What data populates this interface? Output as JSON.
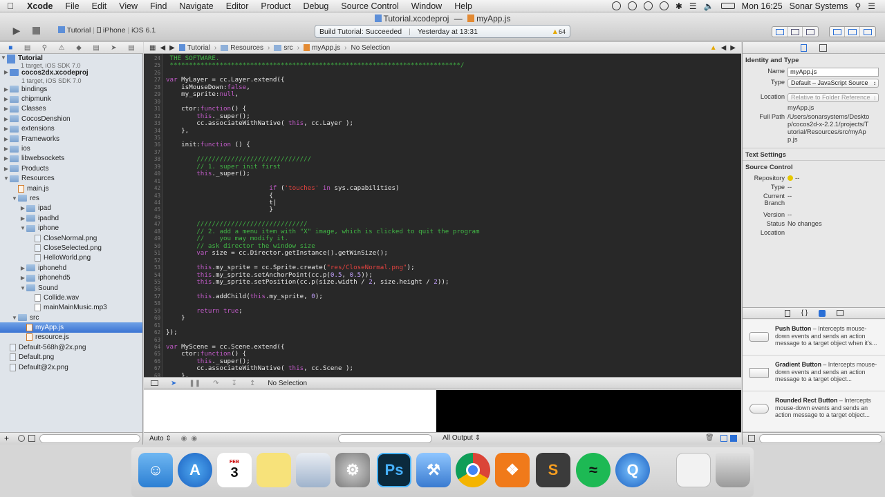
{
  "menubar": {
    "app": "Xcode",
    "items": [
      "File",
      "Edit",
      "View",
      "Find",
      "Navigate",
      "Editor",
      "Product",
      "Debug",
      "Source Control",
      "Window",
      "Help"
    ],
    "clock": "Mon 16:25",
    "user": "Sonar Systems"
  },
  "window": {
    "title_project": "Tutorial.xcodeproj",
    "title_sep": "—",
    "title_file": "myApp.js"
  },
  "toolbar": {
    "scheme": "Tutorial",
    "device": "iPhone",
    "sdk": "iOS 6.1",
    "activity_status": "Build Tutorial: Succeeded",
    "activity_time": "Yesterday at 13:31",
    "warning_count": "64"
  },
  "navigator": {
    "project": {
      "name": "Tutorial",
      "sub": "1 target, iOS SDK 7.0"
    },
    "items": [
      {
        "label": "cocos2dx.xcodeproj",
        "sub": "1 target, iOS SDK 7.0",
        "type": "proj",
        "indent": 1,
        "tri": "closed"
      },
      {
        "label": "bindings",
        "type": "folder",
        "indent": 1,
        "tri": "closed"
      },
      {
        "label": "chipmunk",
        "type": "folder",
        "indent": 1,
        "tri": "closed"
      },
      {
        "label": "Classes",
        "type": "folder",
        "indent": 1,
        "tri": "closed"
      },
      {
        "label": "CocosDenshion",
        "type": "folder",
        "indent": 1,
        "tri": "closed"
      },
      {
        "label": "extensions",
        "type": "folder",
        "indent": 1,
        "tri": "closed"
      },
      {
        "label": "Frameworks",
        "type": "folder",
        "indent": 1,
        "tri": "closed"
      },
      {
        "label": "ios",
        "type": "folder",
        "indent": 1,
        "tri": "closed"
      },
      {
        "label": "libwebsockets",
        "type": "folder",
        "indent": 1,
        "tri": "closed"
      },
      {
        "label": "Products",
        "type": "folder",
        "indent": 1,
        "tri": "closed"
      },
      {
        "label": "Resources",
        "type": "folder",
        "indent": 1,
        "tri": "open"
      },
      {
        "label": "main.js",
        "type": "js",
        "indent": 2,
        "tri": ""
      },
      {
        "label": "res",
        "type": "folder",
        "indent": 2,
        "tri": "open"
      },
      {
        "label": "ipad",
        "type": "folder",
        "indent": 3,
        "tri": "closed"
      },
      {
        "label": "ipadhd",
        "type": "folder",
        "indent": 3,
        "tri": "closed"
      },
      {
        "label": "iphone",
        "type": "folder",
        "indent": 3,
        "tri": "open"
      },
      {
        "label": "CloseNormal.png",
        "type": "img",
        "indent": 4,
        "tri": ""
      },
      {
        "label": "CloseSelected.png",
        "type": "img",
        "indent": 4,
        "tri": ""
      },
      {
        "label": "HelloWorld.png",
        "type": "img",
        "indent": 4,
        "tri": ""
      },
      {
        "label": "iphonehd",
        "type": "folder",
        "indent": 3,
        "tri": "closed"
      },
      {
        "label": "iphonehd5",
        "type": "folder",
        "indent": 3,
        "tri": "closed"
      },
      {
        "label": "Sound",
        "type": "folder",
        "indent": 3,
        "tri": "open"
      },
      {
        "label": "Collide.wav",
        "type": "file",
        "indent": 4,
        "tri": ""
      },
      {
        "label": "mainMainMusic.mp3",
        "type": "file",
        "indent": 4,
        "tri": ""
      },
      {
        "label": "src",
        "type": "folder",
        "indent": 2,
        "tri": "open"
      },
      {
        "label": "myApp.js",
        "type": "js",
        "indent": 3,
        "tri": "",
        "selected": true
      },
      {
        "label": "resource.js",
        "type": "js",
        "indent": 3,
        "tri": ""
      },
      {
        "label": "Default-568h@2x.png",
        "type": "img",
        "indent": 1,
        "tri": ""
      },
      {
        "label": "Default.png",
        "type": "img",
        "indent": 1,
        "tri": ""
      },
      {
        "label": "Default@2x.png",
        "type": "img",
        "indent": 1,
        "tri": ""
      }
    ]
  },
  "jumpbar": {
    "crumbs": [
      "Tutorial",
      "Resources",
      "src",
      "myApp.js",
      "No Selection"
    ]
  },
  "editor": {
    "lines": [
      {
        "n": "24",
        "html": "<span class='cm'> THE SOFTWARE.</span>"
      },
      {
        "n": "25",
        "html": "<span class='cm'> ****************************************************************************/</span>"
      },
      {
        "n": "26",
        "html": ""
      },
      {
        "n": "27",
        "html": "<span class='kw'>var</span> MyLayer = cc.Layer.extend({"
      },
      {
        "n": "28",
        "html": "    isMouseDown:<span class='kw'>false</span>,"
      },
      {
        "n": "29",
        "html": "    my_sprite:<span class='kw'>null</span>,"
      },
      {
        "n": "30",
        "html": ""
      },
      {
        "n": "31",
        "html": "    ctor:<span class='kw'>function</span>() {"
      },
      {
        "n": "32",
        "html": "        <span class='kw'>this</span>._super();"
      },
      {
        "n": "33",
        "html": "        cc.associateWithNative( <span class='kw'>this</span>, cc.Layer );"
      },
      {
        "n": "34",
        "html": "    },"
      },
      {
        "n": "35",
        "html": ""
      },
      {
        "n": "36",
        "html": "    init:<span class='kw'>function</span> () {"
      },
      {
        "n": "37",
        "html": ""
      },
      {
        "n": "38",
        "html": "        <span class='cm'>//////////////////////////////</span>"
      },
      {
        "n": "39",
        "html": "        <span class='cm'>// 1. super init first</span>"
      },
      {
        "n": "40",
        "html": "        <span class='kw'>this</span>._super();"
      },
      {
        "n": "41",
        "html": ""
      },
      {
        "n": "42",
        "html": "                           <span class='kw'>if</span> (<span class='str'>'touches'</span> <span class='kw'>in</span> sys.capabilities)"
      },
      {
        "n": "43",
        "html": "                           {"
      },
      {
        "n": "44",
        "html": "                           t|"
      },
      {
        "n": "45",
        "html": "                           }"
      },
      {
        "n": "46",
        "html": ""
      },
      {
        "n": "47",
        "html": "        <span class='cm'>/////////////////////////////</span>"
      },
      {
        "n": "48",
        "html": "        <span class='cm'>// 2. add a menu item with \"X\" image, which is clicked to quit the program</span>"
      },
      {
        "n": "49",
        "html": "        <span class='cm'>//    you may modify it.</span>"
      },
      {
        "n": "50",
        "html": "        <span class='cm'>// ask director the window size</span>"
      },
      {
        "n": "51",
        "html": "        <span class='kw'>var</span> size = cc.Director.getInstance().getWinSize();"
      },
      {
        "n": "52",
        "html": ""
      },
      {
        "n": "53",
        "html": "        <span class='kw'>this</span>.my_sprite = cc.Sprite.create(<span class='str'>\"res/CloseNormal.png\"</span>);"
      },
      {
        "n": "54",
        "html": "        <span class='kw'>this</span>.my_sprite.setAnchorPoint(cc.p(<span class='num'>0.5</span>, <span class='num'>0.5</span>));"
      },
      {
        "n": "55",
        "html": "        <span class='kw'>this</span>.my_sprite.setPosition(cc.p(size.width / <span class='num'>2</span>, size.height / <span class='num'>2</span>));"
      },
      {
        "n": "56",
        "html": ""
      },
      {
        "n": "57",
        "html": "        <span class='kw'>this</span>.addChild(<span class='kw'>this</span>.my_sprite, <span class='num'>0</span>);"
      },
      {
        "n": "58",
        "html": ""
      },
      {
        "n": "59",
        "html": "        <span class='kw'>return true</span>;"
      },
      {
        "n": "60",
        "html": "    }"
      },
      {
        "n": "61",
        "html": ""
      },
      {
        "n": "62",
        "html": "});"
      },
      {
        "n": "63",
        "html": ""
      },
      {
        "n": "64",
        "html": "<span class='kw'>var</span> MyScene = cc.Scene.extend({"
      },
      {
        "n": "65",
        "html": "    ctor:<span class='kw'>function</span>() {"
      },
      {
        "n": "66",
        "html": "        <span class='kw'>this</span>._super();"
      },
      {
        "n": "67",
        "html": "        cc.associateWithNative( <span class='kw'>this</span>, cc.Scene );"
      },
      {
        "n": "68",
        "html": "    },"
      }
    ]
  },
  "debug": {
    "selection": "No Selection",
    "variables_mode": "Auto",
    "console_mode": "All Output"
  },
  "inspector": {
    "identity_title": "Identity and Type",
    "name_label": "Name",
    "name_value": "myApp.js",
    "type_label": "Type",
    "type_value": "Default – JavaScript Source",
    "location_label": "Location",
    "location_value": "Relative to Folder Reference",
    "location_file": "myApp.js",
    "fullpath_label": "Full Path",
    "fullpath_value": "/Users/sonarsystems/Desktop/cocos2d-x-2.2.1/projects/Tutorial/Resources/src/myApp.js",
    "text_settings": "Text Settings",
    "source_control": "Source Control",
    "repository_label": "Repository",
    "repository_value": "--",
    "sc_type_label": "Type",
    "sc_type_value": "--",
    "branch_label": "Current Branch",
    "branch_value": "--",
    "version_label": "Version",
    "version_value": "--",
    "status_label": "Status",
    "status_value": "No changes",
    "sc_location_label": "Location"
  },
  "library": [
    {
      "title": "Push Button",
      "desc": " – Intercepts mouse-down events and sends an action message to a target object when it's..."
    },
    {
      "title": "Gradient Button",
      "desc": " – Intercepts mouse-down events and sends an action message to a target object..."
    },
    {
      "title": "Rounded Rect Button",
      "desc": " – Intercepts mouse-down events and sends an action message to a target object..."
    }
  ],
  "dock": {
    "calendar_day": "3",
    "calendar_month": "FEB",
    "apps": [
      "finder-icon",
      "appstore-icon",
      "calendar-icon",
      "stickies-icon",
      "preview-icon",
      "system-preferences-icon",
      "photoshop-icon",
      "xcode-icon",
      "chrome-icon",
      "xampp-icon",
      "sublime-icon",
      "spotify-icon",
      "quicktime-icon",
      "documents-icon",
      "trash-icon"
    ]
  },
  "colors": {
    "selection": "#3b74d3",
    "editor_bg": "#282828",
    "keyword": "#c25bc9",
    "string": "#e3423f",
    "comment": "#41b645"
  }
}
